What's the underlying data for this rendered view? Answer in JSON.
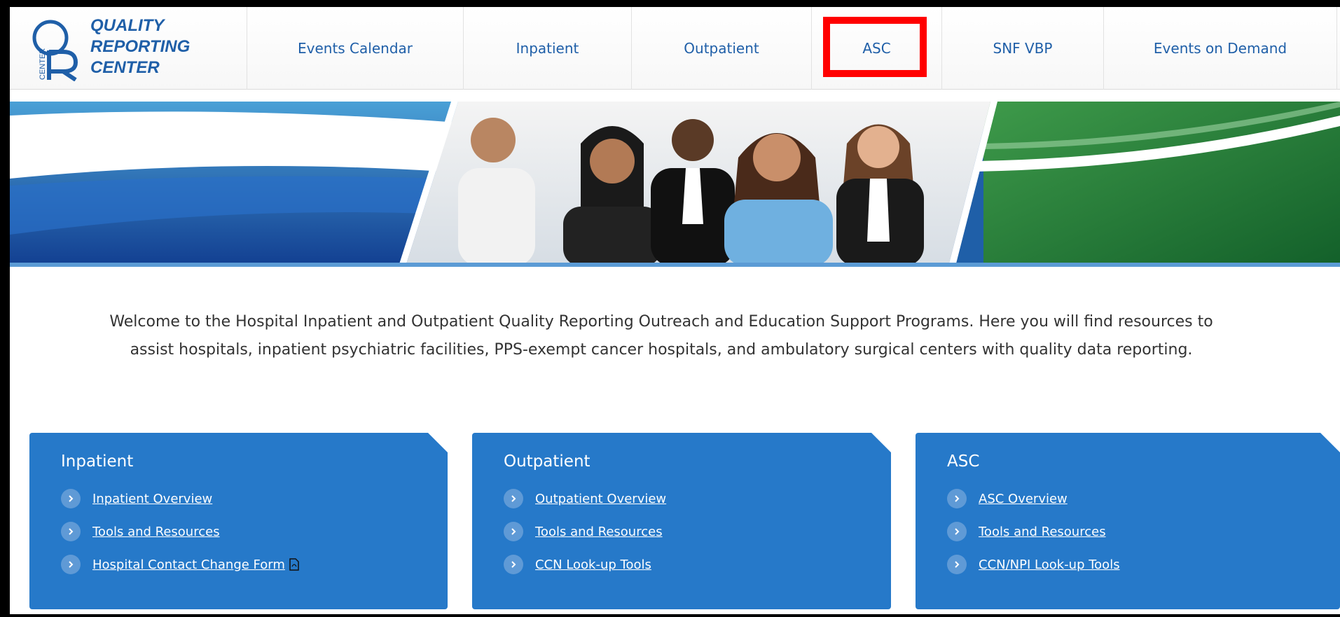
{
  "logo": {
    "line1": "QUALITY",
    "line2": "REPORTING",
    "line3": "CENTER",
    "mark_text": "CENTER"
  },
  "nav": {
    "items": [
      {
        "label": "Events Calendar"
      },
      {
        "label": "Inpatient"
      },
      {
        "label": "Outpatient"
      },
      {
        "label": "ASC",
        "highlighted": true
      },
      {
        "label": "SNF VBP"
      },
      {
        "label": "Events on Demand"
      }
    ]
  },
  "welcome": {
    "line1": "Welcome to the Hospital Inpatient and Outpatient Quality Reporting Outreach and Education Support Programs. Here you will find resources to",
    "line2": "assist hospitals, inpatient psychiatric facilities, PPS-exempt cancer hospitals, and ambulatory surgical centers with quality data reporting."
  },
  "cards": [
    {
      "title": "Inpatient",
      "links": [
        "Inpatient Overview",
        "Tools and Resources",
        "Hospital Contact Change Form"
      ]
    },
    {
      "title": "Outpatient",
      "links": [
        "Outpatient Overview",
        "Tools and Resources",
        "CCN Look-up Tools"
      ]
    },
    {
      "title": "ASC",
      "links": [
        "ASC Overview",
        "Tools and Resources",
        "CCN/NPI Look-up Tools"
      ]
    }
  ],
  "colors": {
    "brand_blue": "#1f5fa8",
    "card_blue": "#2679c9",
    "highlight_red": "#ff0000",
    "banner_green": "#2e7d32"
  },
  "icons": {
    "chevron": "chevron-right-icon",
    "pdf": "pdf-icon"
  }
}
